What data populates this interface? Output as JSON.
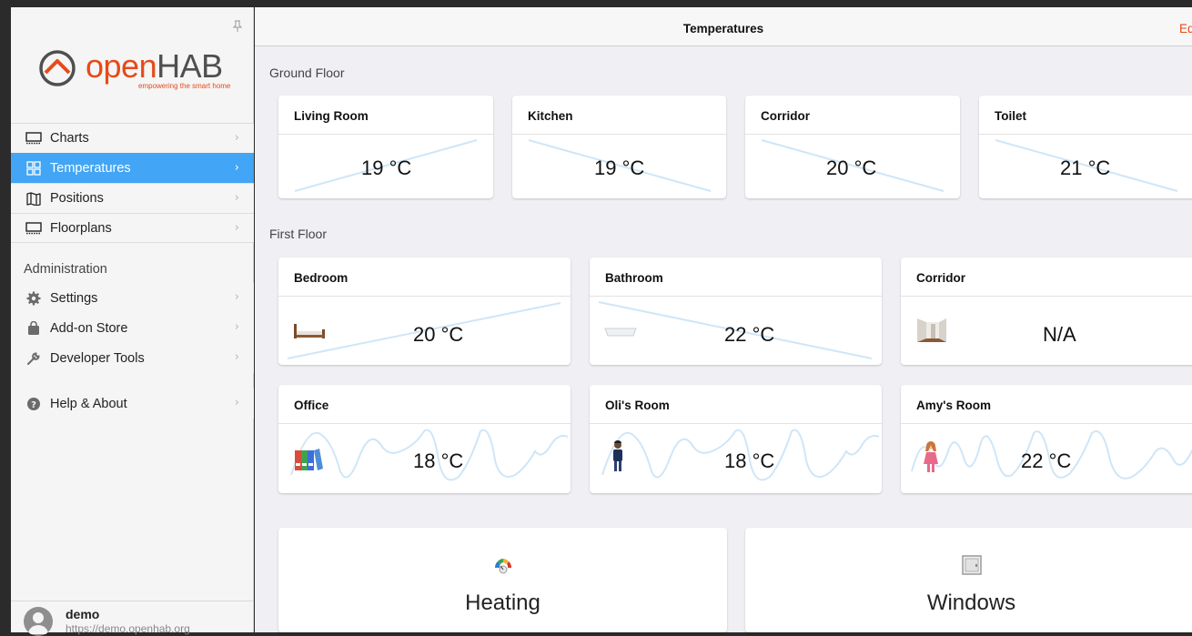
{
  "sidebar": {
    "logo_main": "open",
    "logo_hab": "HAB",
    "logo_tagline": "empowering the smart home",
    "items": [
      {
        "label": "Charts",
        "icon": "chart-display-icon"
      },
      {
        "label": "Temperatures",
        "icon": "grid-icon",
        "active": true
      },
      {
        "label": "Positions",
        "icon": "map-icon"
      },
      {
        "label": "Floorplans",
        "icon": "floorplan-display-icon"
      }
    ],
    "admin_title": "Administration",
    "admin_items": [
      {
        "label": "Settings",
        "icon": "gear-icon"
      },
      {
        "label": "Add-on Store",
        "icon": "shopping-bag-icon"
      },
      {
        "label": "Developer Tools",
        "icon": "wrench-icon"
      }
    ],
    "help_label": "Help & About",
    "user": {
      "name": "demo",
      "url": "https://demo.openhab.org"
    }
  },
  "topbar": {
    "title": "Temperatures",
    "edit_label": "Edit"
  },
  "ground_floor": {
    "title": "Ground Floor",
    "rooms": [
      {
        "name": "Living Room",
        "value": "19 °C"
      },
      {
        "name": "Kitchen",
        "value": "19 °C"
      },
      {
        "name": "Corridor",
        "value": "20 °C"
      },
      {
        "name": "Toilet",
        "value": "21 °C"
      }
    ]
  },
  "first_floor": {
    "title": "First Floor",
    "rooms": [
      {
        "name": "Bedroom",
        "value": "20 °C",
        "icon": "bed-icon"
      },
      {
        "name": "Bathroom",
        "value": "22 °C",
        "icon": "bathtub-icon"
      },
      {
        "name": "Corridor",
        "value": "N/A",
        "icon": "corridor-icon"
      },
      {
        "name": "Office",
        "value": "18 °C",
        "icon": "office-binders-icon"
      },
      {
        "name": "Oli's Room",
        "value": "18 °C",
        "icon": "boy-icon"
      },
      {
        "name": "Amy's Room",
        "value": "22 °C",
        "icon": "girl-icon"
      }
    ]
  },
  "tiles": [
    {
      "label": "Heating",
      "icon": "heating-gauge-icon"
    },
    {
      "label": "Windows",
      "icon": "window-icon"
    }
  ],
  "colors": {
    "accent": "#42a5f5",
    "brand": "#e64a19",
    "trend": "#cfe6f7"
  }
}
